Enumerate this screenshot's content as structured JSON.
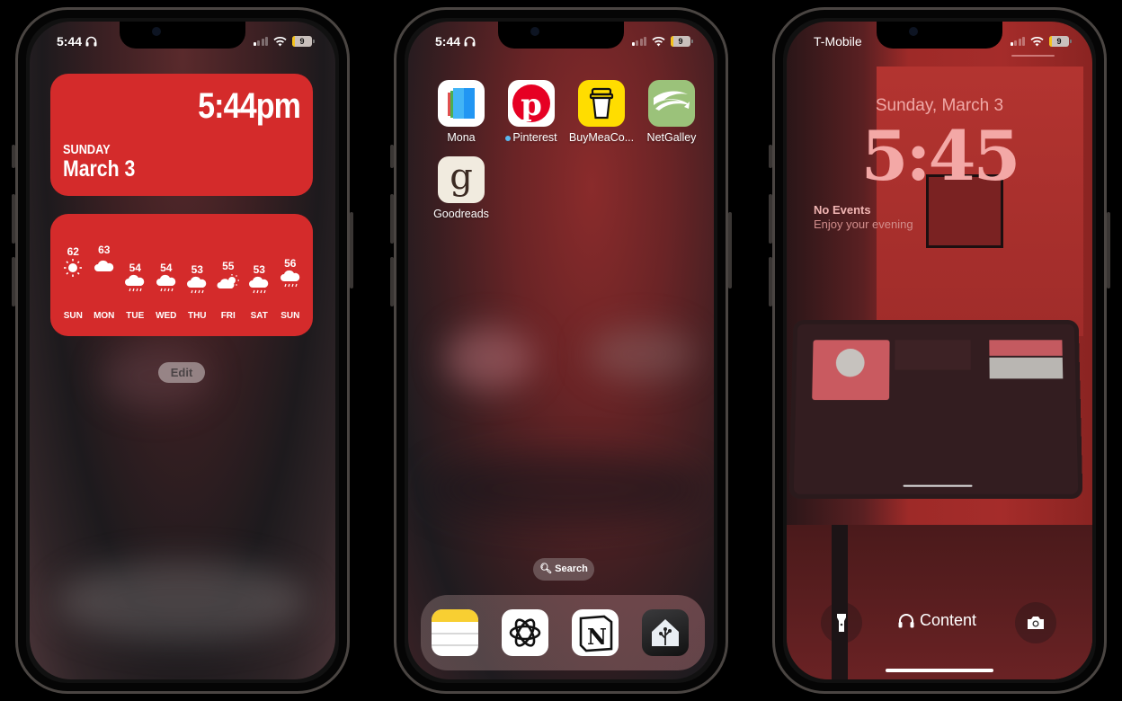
{
  "phones": [
    {
      "status": {
        "time": "5:44",
        "battery": "9"
      },
      "clock_widget": {
        "time": "5:44pm",
        "day": "SUNDAY",
        "date": "March 3"
      },
      "weather_widget": {
        "forecast": [
          {
            "day": "SUN",
            "temp": "62",
            "condition": "sunny"
          },
          {
            "day": "MON",
            "temp": "63",
            "condition": "cloudy"
          },
          {
            "day": "TUE",
            "temp": "54",
            "condition": "rain"
          },
          {
            "day": "WED",
            "temp": "54",
            "condition": "rain"
          },
          {
            "day": "THU",
            "temp": "53",
            "condition": "rain"
          },
          {
            "day": "FRI",
            "temp": "55",
            "condition": "partly-cloudy"
          },
          {
            "day": "SAT",
            "temp": "53",
            "condition": "rain"
          },
          {
            "day": "SUN",
            "temp": "56",
            "condition": "rain"
          }
        ]
      },
      "edit_label": "Edit"
    },
    {
      "status": {
        "time": "5:44",
        "battery": "9"
      },
      "apps": [
        {
          "label": "Mona",
          "icon": "mona-icon"
        },
        {
          "label": "Pinterest",
          "icon": "pinterest-icon",
          "badge_dot": true
        },
        {
          "label": "BuyMeaCo...",
          "icon": "buymeacoffee-icon"
        },
        {
          "label": "NetGalley",
          "icon": "netgalley-icon"
        },
        {
          "label": "Goodreads",
          "icon": "goodreads-icon"
        }
      ],
      "search_label": "Search",
      "dock": [
        {
          "name": "Notes",
          "icon": "notes-icon"
        },
        {
          "name": "ChatGPT",
          "icon": "chatgpt-icon"
        },
        {
          "name": "Notion",
          "icon": "notion-icon"
        },
        {
          "name": "Home Assistant",
          "icon": "home-assistant-icon"
        }
      ]
    },
    {
      "status": {
        "carrier": "T-Mobile",
        "battery": "9"
      },
      "lock": {
        "date": "Sunday, March 3",
        "time": "5:45",
        "events_title": "No Events",
        "events_subtitle": "Enjoy your evening",
        "focus_label": "Content"
      }
    }
  ],
  "colors": {
    "widget_red": "#d42b2b",
    "lock_text": "#f3a8a6"
  }
}
